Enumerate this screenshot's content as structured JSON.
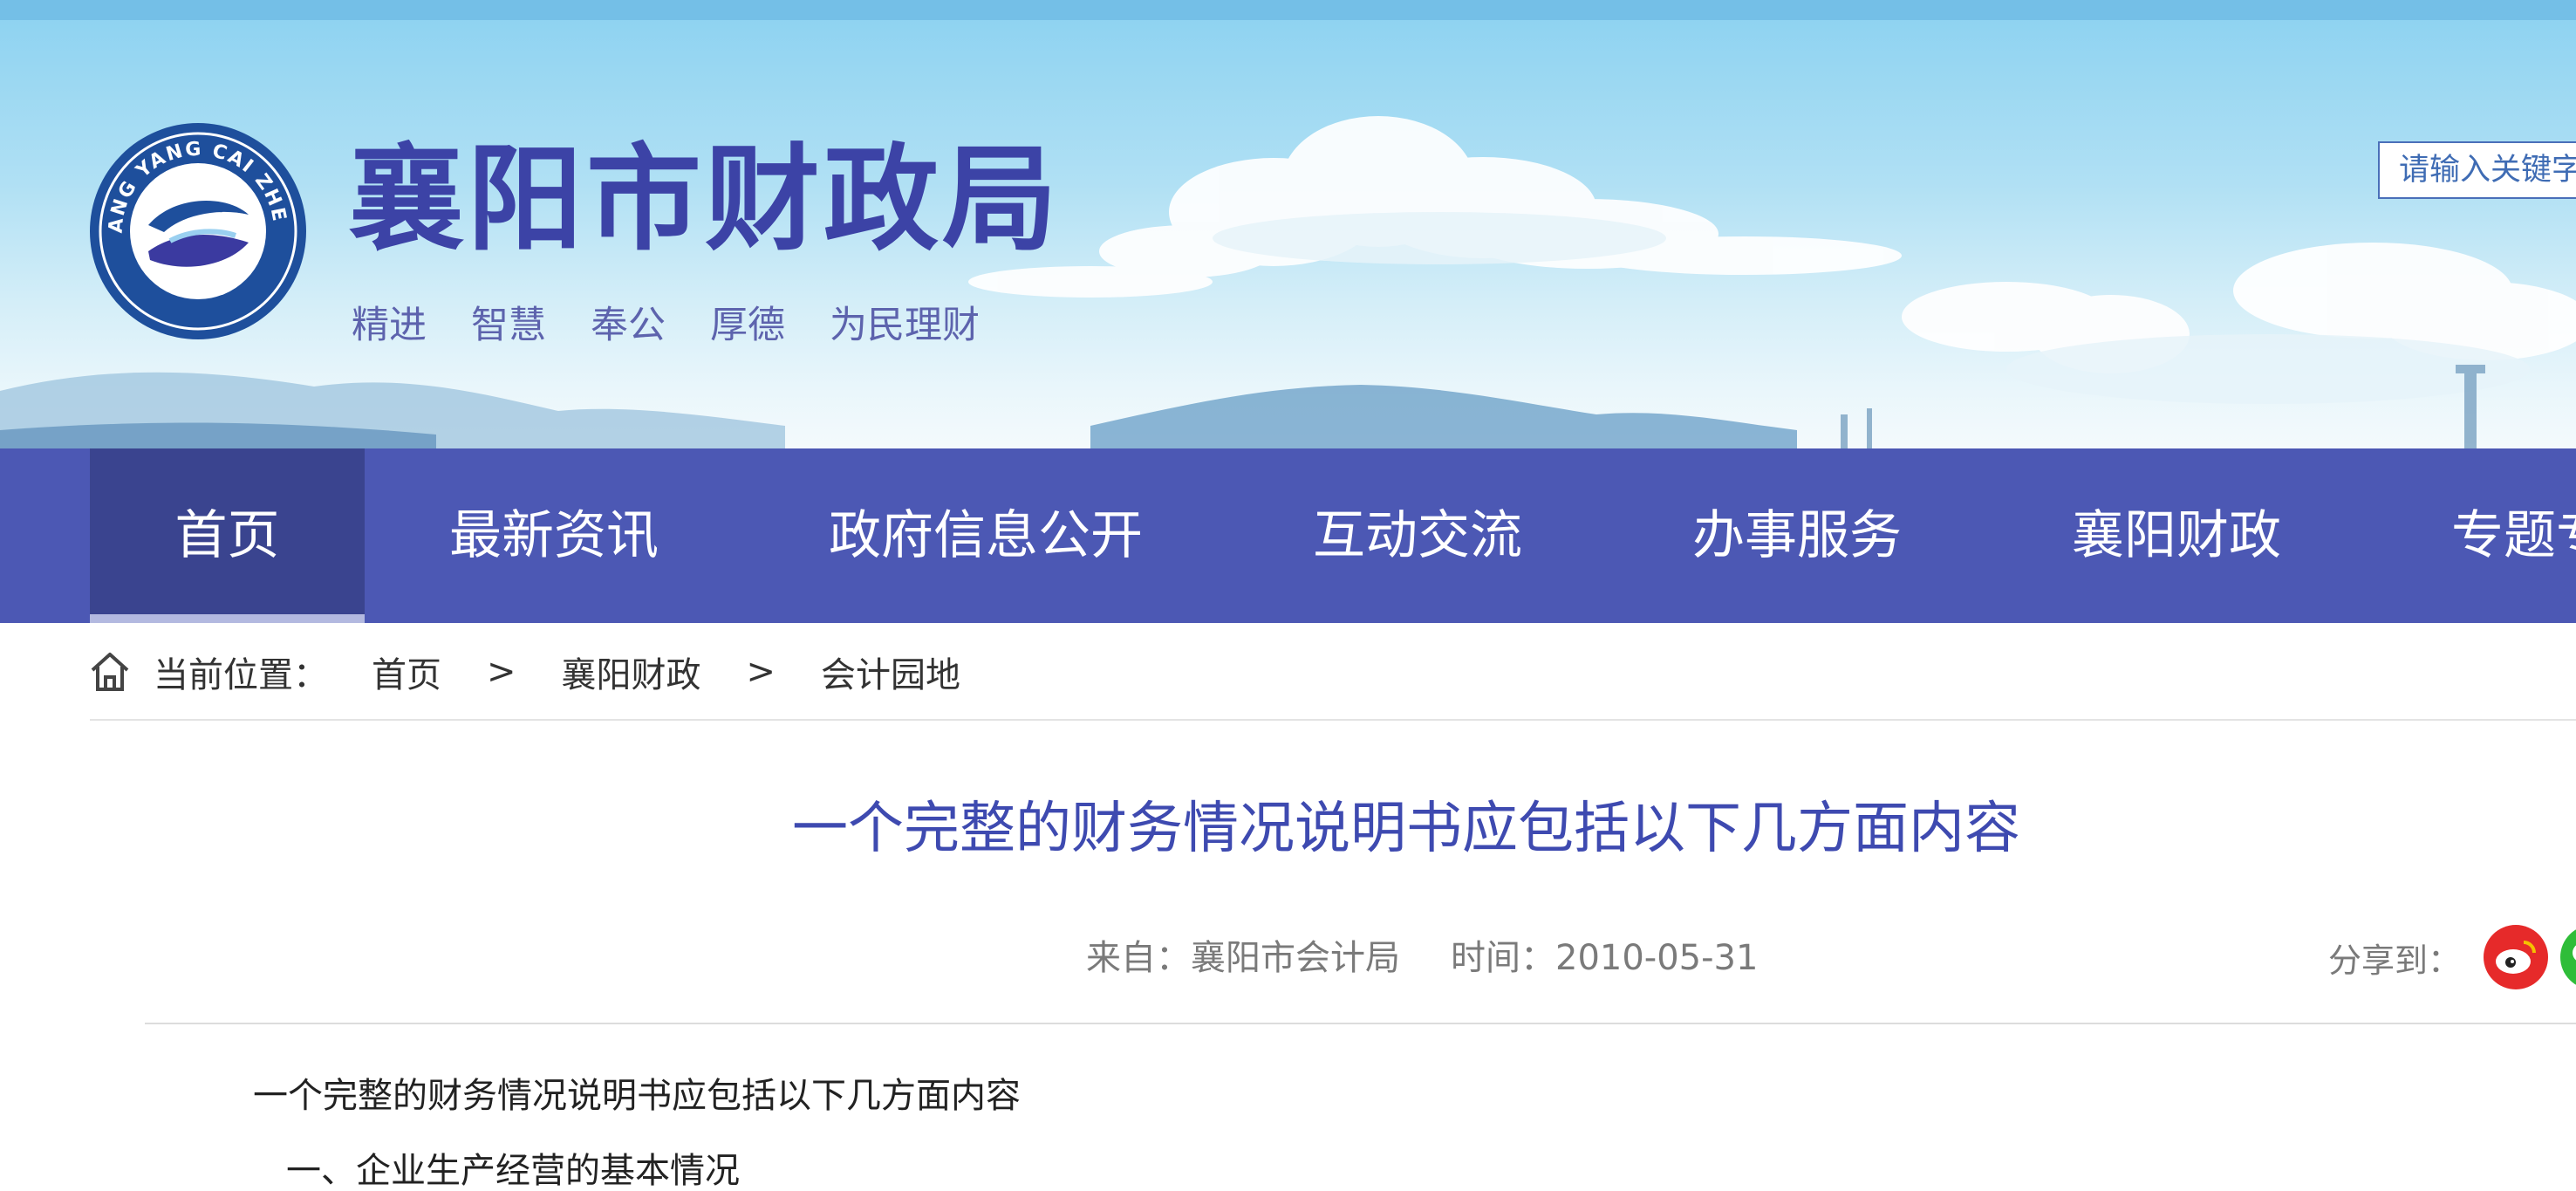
{
  "site": {
    "title": "襄阳市财政局",
    "slogan": [
      "精进",
      "智慧",
      "奉公",
      "厚德",
      "为民理财"
    ],
    "logo_text": "XIANG YANG CAI ZHENG"
  },
  "search": {
    "placeholder": "请输入关键字"
  },
  "nav": {
    "items": [
      {
        "label": "首页",
        "active": true
      },
      {
        "label": "最新资讯"
      },
      {
        "label": "政府信息公开"
      },
      {
        "label": "互动交流"
      },
      {
        "label": "办事服务"
      },
      {
        "label": "襄阳财政"
      },
      {
        "label": "专题专"
      }
    ]
  },
  "breadcrumb": {
    "label": "当前位置：",
    "items": [
      "首页",
      "襄阳财政",
      "会计园地"
    ],
    "separator": ">"
  },
  "article": {
    "title": "一个完整的财务情况说明书应包括以下几方面内容",
    "source": "来自：襄阳市会计局",
    "time": "时间：2010-05-31",
    "body": [
      "一个完整的财务情况说明书应包括以下几方面内容",
      "一、企业生产经营的基本情况"
    ]
  },
  "share": {
    "label": "分享到：",
    "icons": [
      "weibo-icon",
      "wechat-icon"
    ]
  },
  "colors": {
    "accent": "#3c43a6",
    "nav_bg": "#4c58b4",
    "nav_active": "#3a448f",
    "top_strip": "#74bfe7",
    "weibo": "#e62a2a",
    "wechat": "#2fbd39"
  }
}
